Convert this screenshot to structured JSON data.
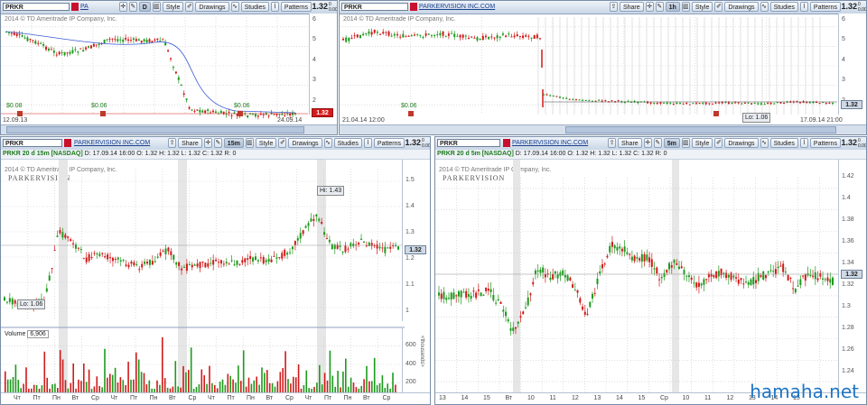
{
  "p1": {
    "symbol": "PRKR",
    "company": "PA",
    "interval": "D",
    "labels": {
      "style": "Style",
      "drawings": "Drawings",
      "studies": "Studies",
      "patterns": "Patterns"
    },
    "price": "1.32",
    "change": "0 0.00%",
    "copyright": "2014 © TD Ameritrade IP Company, Inc.",
    "yticks": [
      "6",
      "5",
      "4",
      "3",
      "2"
    ],
    "price_label": "1.32",
    "x_first": "12.09.13",
    "x_last": "24.09.14",
    "dividends": [
      "$0.08",
      "$0.06",
      "$0.06"
    ]
  },
  "p2": {
    "symbol": "PRKR",
    "company": "PARKERVISION INC.COM",
    "interval": "1h",
    "labels": {
      "share": "Share",
      "style": "Style",
      "drawings": "Drawings",
      "studies": "Studies",
      "patterns": "Patterns"
    },
    "price": "1.32",
    "change": "0 0.00%",
    "copyright": "2014 © TD Ameritrade IP Company, Inc.",
    "yticks": [
      "6",
      "5",
      "4",
      "3",
      "2"
    ],
    "price_label": "1.32",
    "low": "Lo: 1.06",
    "x_first": "21.04.14 12:00",
    "x_last": "17.09.14 21:00",
    "dividends": [
      "$0.06"
    ]
  },
  "p3": {
    "symbol": "PRKR",
    "company": "PARKERVISION INC.COM",
    "interval": "15m",
    "labels": {
      "share": "Share",
      "style": "Style",
      "drawings": "Drawings",
      "studies": "Studies",
      "patterns": "Patterns"
    },
    "price": "1.32",
    "change": "0 0.00%",
    "info_title": "PRKR 20 d 15m [NASDAQ]",
    "info_rest": "D: 17.09.14 16:00   O: 1.32   H: 1.32   L: 1.32   C: 1.32   R: 0",
    "copyright": "2014 © TD Ameritrade IP Company, Inc.",
    "logo": "PARKERVISION",
    "yticks": [
      "1.5",
      "1.4",
      "1.3",
      "1.2",
      "1.1",
      "1"
    ],
    "price_label": "1.32",
    "high": "Hi: 1.43",
    "low": "Lo: 1.06",
    "volume_title": "Volume",
    "volume_value": "6,906",
    "vol_ticks": [
      "600",
      "400",
      "200"
    ],
    "vol_unit": "<thousands>",
    "xticks": [
      "Чт",
      "Пт",
      "Пн",
      "Вт",
      "Ср",
      "Чт",
      "Пт",
      "Пн",
      "Вт",
      "Ср",
      "Чт",
      "Пт",
      "Пн",
      "Вт",
      "Ср",
      "Чт",
      "Пт",
      "Пн",
      "Вт",
      "Ср"
    ]
  },
  "p4": {
    "symbol": "PRKR",
    "company": "PARKERVISION INC.COM",
    "interval": "5m",
    "labels": {
      "share": "Share",
      "style": "Style",
      "drawings": "Drawings",
      "studies": "Studies",
      "patterns": "Patterns"
    },
    "price": "1.32",
    "change": "0 0.00%",
    "info_title": "PRKR 20 d 5m [NASDAQ]",
    "info_rest": "D: 17.09.14 16:00   O: 1.32   H: 1.32   L: 1.32   C: 1.32   R: 0",
    "copyright": "2014 © TD Ameritrade IP Company, Inc.",
    "logo": "PARKERVISION",
    "yticks": [
      "1.42",
      "1.4",
      "1.38",
      "1.36",
      "1.34",
      "1.32",
      "1.3",
      "1.28",
      "1.26",
      "1.24"
    ],
    "price_label": "1.32",
    "xticks": [
      "13",
      "14",
      "15",
      "Вт",
      "10",
      "11",
      "12",
      "13",
      "14",
      "15",
      "Ср",
      "10",
      "11",
      "12",
      "13",
      "14",
      "15"
    ]
  },
  "watermark_brand": "hamaha.net",
  "colors": {
    "up": "#1d9a1d",
    "down": "#d11a1a",
    "frame": "#7a8ea8",
    "toolbar": "#c9d6e6",
    "price_red": "#d41b1b"
  }
}
